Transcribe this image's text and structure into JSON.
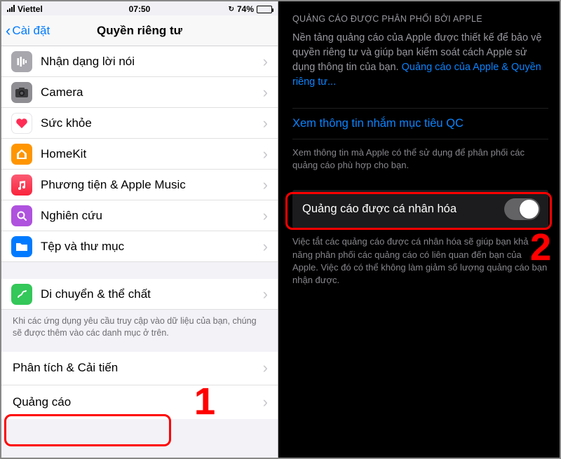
{
  "left": {
    "status": {
      "carrier": "Viettel",
      "time": "07:50",
      "battery_pct": "74%",
      "lpm_glyph": "↻"
    },
    "nav": {
      "back": "Cài đặt",
      "title": "Quyền riêng tư"
    },
    "rows": [
      {
        "icon": "speech-icon",
        "label": "Nhận dạng lời nói"
      },
      {
        "icon": "camera-icon",
        "label": "Camera"
      },
      {
        "icon": "health-icon",
        "label": "Sức khỏe"
      },
      {
        "icon": "homekit-icon",
        "label": "HomeKit"
      },
      {
        "icon": "music-icon",
        "label": "Phương tiện & Apple Music"
      },
      {
        "icon": "research-icon",
        "label": "Nghiên cứu"
      },
      {
        "icon": "files-icon",
        "label": "Tệp và thư mục"
      }
    ],
    "fitness": {
      "icon": "fitness-icon",
      "label": "Di chuyển & thể chất"
    },
    "footer": "Khi các ứng dụng yêu cầu truy cập vào dữ liệu của bạn, chúng sẽ được thêm vào các danh mục ở trên.",
    "group2": [
      {
        "label": "Phân tích & Cải tiến"
      },
      {
        "label": "Quảng cáo"
      }
    ]
  },
  "right": {
    "header": "QUẢNG CÁO ĐƯỢC PHÂN PHỐI BỞI APPLE",
    "body_plain": "Nền tảng quảng cáo của Apple được thiết kế để bảo vệ quyền riêng tư và giúp bạn kiểm soát cách Apple sử dụng thông tin của bạn. ",
    "body_link": "Quảng cáo của Apple & Quyền riêng tư...",
    "view_info": "Xem thông tin nhắm mục tiêu QC",
    "view_info_foot": "Xem thông tin mà Apple có thể sử dụng để phân phối các quảng cáo phù hợp cho bạn.",
    "toggle_label": "Quảng cáo được cá nhân hóa",
    "toggle_foot": "Việc tắt các quảng cáo được cá nhân hóa sẽ giúp bạn khả năng phân phối các quảng cáo có liên quan đến bạn của Apple. Việc đó có thể không làm giảm số lượng quảng cáo bạn nhận được."
  },
  "annotations": {
    "one": "1",
    "two": "2"
  }
}
